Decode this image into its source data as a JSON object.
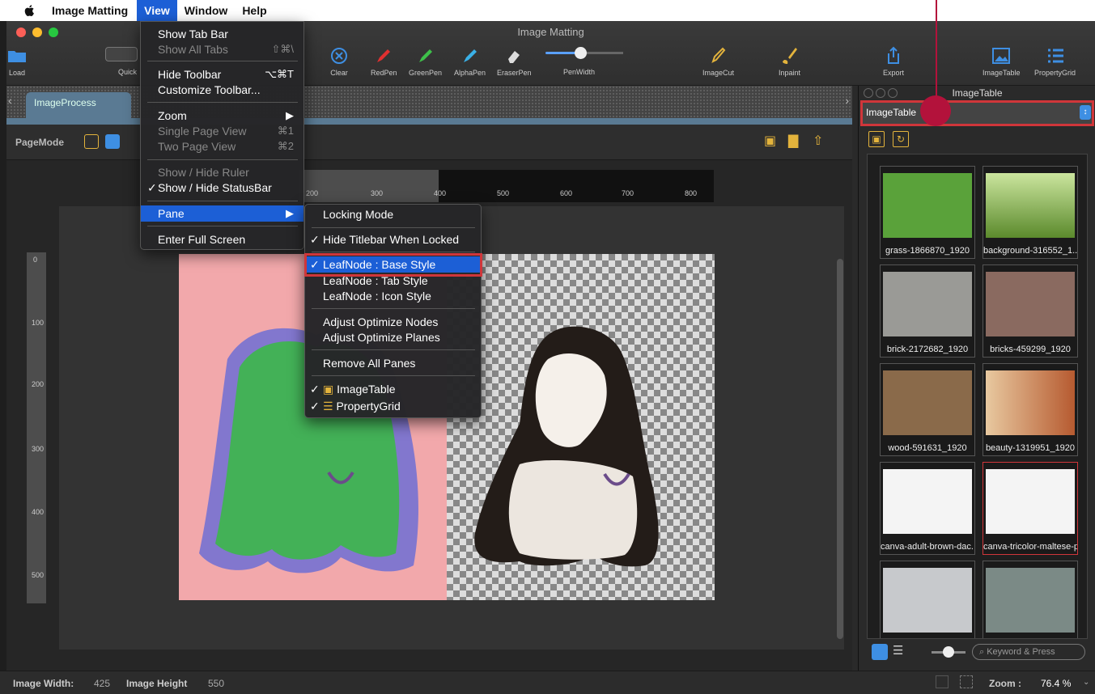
{
  "menubar": {
    "app_name": "Image Matting",
    "items": [
      "View",
      "Window",
      "Help"
    ]
  },
  "window": {
    "title": "Image Matting",
    "toolbar": {
      "load": "Load",
      "quick": "Quick",
      "clear": "Clear",
      "red_pen": "RedPen",
      "green_pen": "GreenPen",
      "alpha_pen": "AlphaPen",
      "eraser_pen": "EraserPen",
      "pen_width": "PenWidth",
      "image_cut": "ImageCut",
      "inpaint": "Inpaint",
      "export": "Export",
      "image_table": "ImageTable",
      "property_grid": "PropertyGrid"
    },
    "tab": "ImageProcess",
    "page_mode_label": "PageMode",
    "hruler_labels": [
      "200",
      "300",
      "400",
      "500",
      "600",
      "700",
      "800"
    ],
    "vruler_labels": [
      "0",
      "100",
      "200",
      "300",
      "400",
      "500"
    ]
  },
  "view_menu": {
    "show_tab_bar": "Show Tab Bar",
    "show_all_tabs": "Show All Tabs",
    "show_all_tabs_sc": "⇧⌘\\",
    "hide_toolbar": "Hide Toolbar",
    "hide_toolbar_sc": "⌥⌘T",
    "customize_toolbar": "Customize Toolbar...",
    "zoom": "Zoom",
    "single_page": "Single Page View",
    "single_page_sc": "⌘1",
    "two_page": "Two Page View",
    "two_page_sc": "⌘2",
    "show_ruler": "Show / Hide Ruler",
    "show_statusbar": "Show / Hide StatusBar",
    "pane": "Pane",
    "full_screen": "Enter Full Screen"
  },
  "pane_menu": {
    "locking_mode": "Locking Mode",
    "hide_titlebar": "Hide Titlebar When Locked",
    "leaf_base": "LeafNode : Base Style",
    "leaf_tab": "LeafNode : Tab Style",
    "leaf_icon": "LeafNode : Icon Style",
    "adjust_nodes": "Adjust Optimize Nodes",
    "adjust_planes": "Adjust Optimize Planes",
    "remove_all": "Remove All Panes",
    "image_table": "ImageTable",
    "property_grid": "PropertyGrid"
  },
  "status": {
    "width_label": "Image Width:",
    "width_value": "425",
    "height_label": "Image Height",
    "height_value": "550",
    "zoom_label": "Zoom :",
    "zoom_value": "76.4 %"
  },
  "right_panel": {
    "title": "ImageTable",
    "select_value": "ImageTable",
    "search_placeholder": "Keyword & Press",
    "thumbnails": [
      {
        "caption": "grass-1866870_1920",
        "color": "#5aa23a"
      },
      {
        "caption": "background-316552_1...",
        "color": "#7fb64d"
      },
      {
        "caption": "brick-2172682_1920",
        "color": "#9a9a96"
      },
      {
        "caption": "bricks-459299_1920",
        "color": "#8a6a60"
      },
      {
        "caption": "wood-591631_1920",
        "color": "#8a6a4a"
      },
      {
        "caption": "beauty-1319951_1920",
        "color": "#e1a77c"
      },
      {
        "caption": "canva-adult-brown-dac...",
        "color": "#f4f4f4"
      },
      {
        "caption": "canva-tricolor-maltese-p...",
        "color": "#f4f4f4"
      },
      {
        "caption": "",
        "color": "#c7c9cc"
      },
      {
        "caption": "",
        "color": "#7b8a86"
      }
    ]
  },
  "colors": {
    "accent": "#1c5fd6",
    "highlight_outline": "#d0363a",
    "callout": "#b3123b",
    "icon_gold": "#e3b33c"
  }
}
